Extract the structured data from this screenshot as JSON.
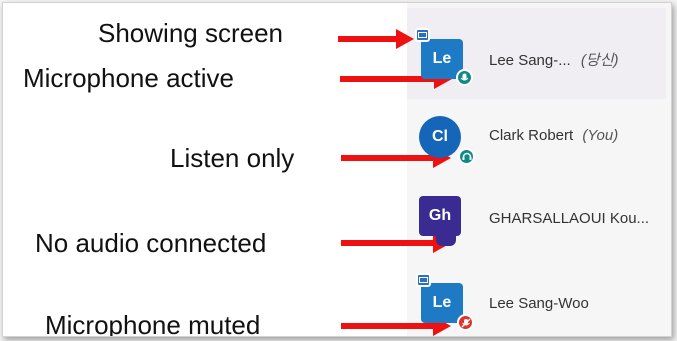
{
  "captions": {
    "showing_screen": "Showing screen",
    "microphone_active": "Microphone active",
    "listen_only": "Listen only",
    "no_audio": "No audio connected",
    "microphone_muted": "Microphone muted"
  },
  "participants": [
    {
      "initials": "Le",
      "name": "Lee Sang-...",
      "suffix": "(당신)",
      "avatar_shape": "square",
      "avatar_color": "#1f7ac6",
      "presenting": true,
      "audio": "microphone-active"
    },
    {
      "initials": "Cl",
      "name": "Clark Robert",
      "suffix": "(You)",
      "avatar_shape": "circle",
      "avatar_color": "#1565b8",
      "presenting": false,
      "audio": "listen-only"
    },
    {
      "initials": "Gh",
      "name": "GHARSALLAOUI Kou...",
      "suffix": "",
      "avatar_shape": "square",
      "avatar_color": "#3a2b93",
      "presenting": false,
      "audio": "none"
    },
    {
      "initials": "Le",
      "name": "Lee Sang-Woo",
      "suffix": "",
      "avatar_shape": "square",
      "avatar_color": "#1f7ac6",
      "presenting": true,
      "audio": "microphone-muted"
    }
  ],
  "colors": {
    "arrow": "#ee1111",
    "status_active": "#0f8a86",
    "status_muted": "#e0322a",
    "screen_badge": "#2b6fc2"
  }
}
